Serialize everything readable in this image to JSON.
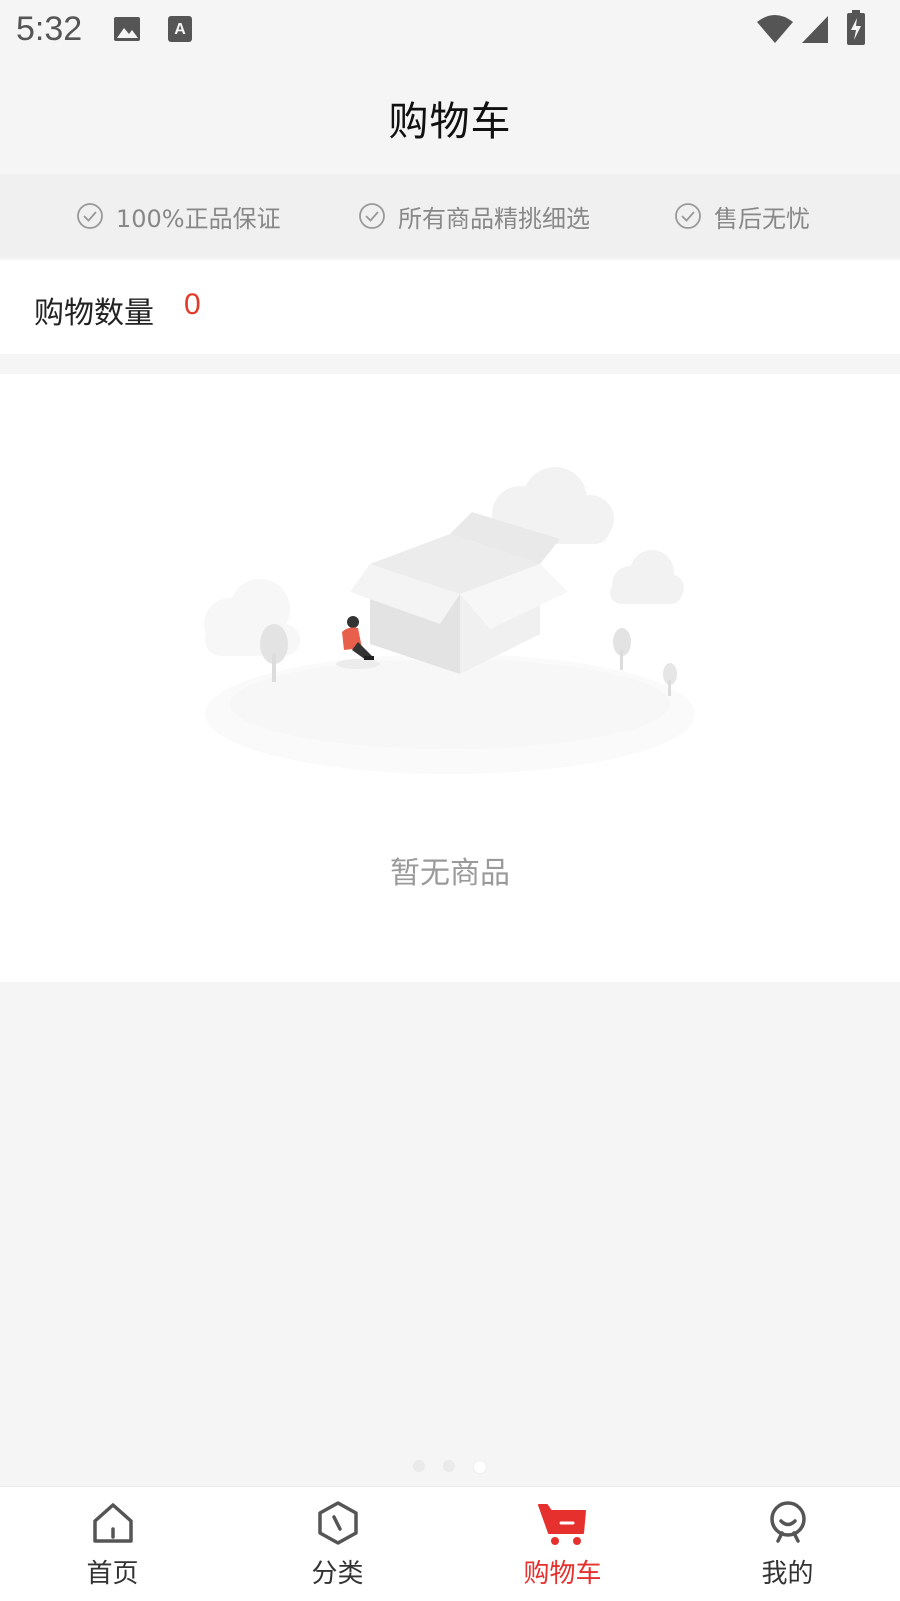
{
  "status_bar": {
    "time": "5:32",
    "icons": [
      "image-icon",
      "text-a-icon",
      "wifi-icon",
      "signal-icon",
      "battery-charging-icon"
    ]
  },
  "header": {
    "title": "购物车"
  },
  "guarantees": [
    {
      "icon": "check-circle-icon",
      "label": "100%正品保证"
    },
    {
      "icon": "check-circle-icon",
      "label": "所有商品精挑细选"
    },
    {
      "icon": "check-circle-icon",
      "label": "售后无忧"
    }
  ],
  "cart": {
    "count_label": "购物数量",
    "count_value": "0",
    "empty_text": "暂无商品",
    "empty_illustration": "empty-box-illustration"
  },
  "tabbar": {
    "items": [
      {
        "icon": "home-icon",
        "label": "首页",
        "active": false
      },
      {
        "icon": "category-icon",
        "label": "分类",
        "active": false
      },
      {
        "icon": "cart-icon",
        "label": "购物车",
        "active": true
      },
      {
        "icon": "profile-icon",
        "label": "我的",
        "active": false
      }
    ]
  },
  "colors": {
    "accent": "#e5302e",
    "count_value": "#e23a2b",
    "background": "#f5f5f5"
  }
}
